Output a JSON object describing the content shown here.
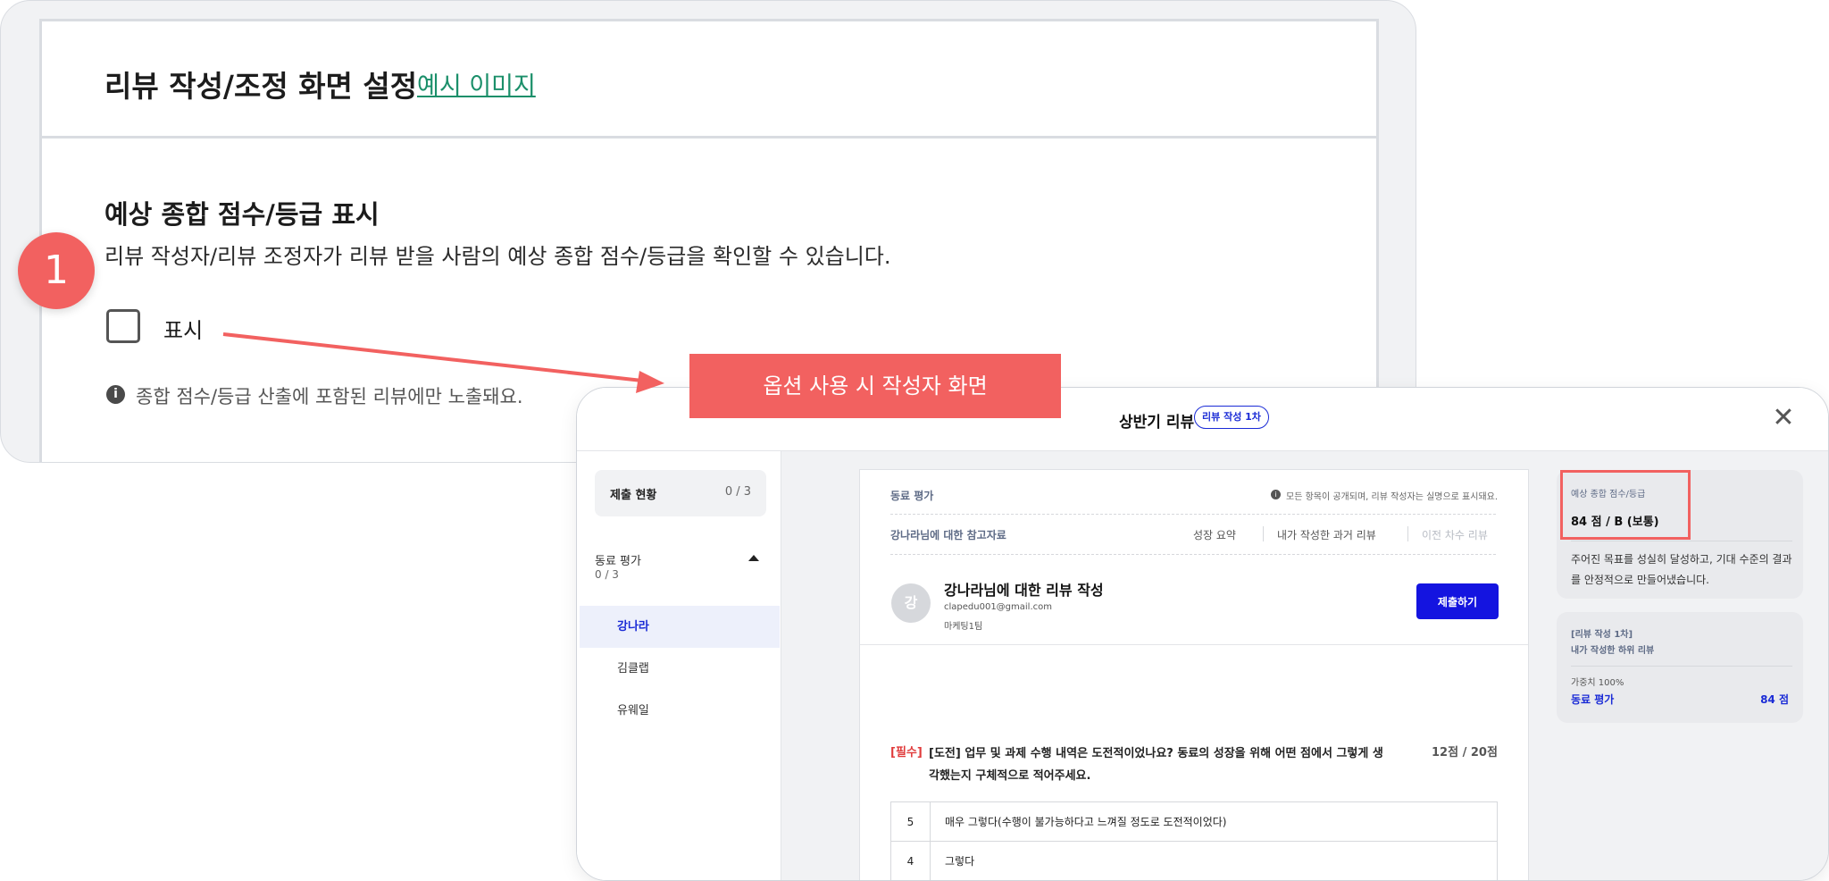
{
  "settings": {
    "title": "리뷰 작성/조정 화면 설정",
    "example_link": "예시 이미지",
    "section_title": "예상 종합 점수/등급 표시",
    "section_desc": "리뷰 작성자/리뷰 조정자가 리뷰 받을 사람의 예상 종합 점수/등급을 확인할 수 있습니다.",
    "checkbox_label": "표시",
    "checkbox_checked": false,
    "notice_icon": "info-icon",
    "notice_icon_glyph": "i",
    "notice": "종합 점수/등급 산출에 포함된 리뷰에만 노출돼요."
  },
  "annotation": {
    "step": "1",
    "callout": "옵션 사용 시 작성자 화면",
    "accent_color": "#f26160"
  },
  "modal": {
    "title": "상반기 리뷰",
    "badge": "리뷰 작성 1차",
    "close_glyph": "✕",
    "sidebar": {
      "progress_label": "제출 현황",
      "progress_value": "0 / 3",
      "group_title": "동료 평가",
      "group_count": "0 / 3",
      "items": [
        {
          "label": "강나라",
          "active": true
        },
        {
          "label": "김클랩",
          "active": false
        },
        {
          "label": "유웨일",
          "active": false
        }
      ]
    },
    "panel": {
      "label": "동료 평가",
      "info_note": "모든 항목이 공개되며, 리뷰 작성자는 실명으로 표시돼요.",
      "ref_label": "강나라님에 대한 참고자료",
      "ref_tabs": [
        {
          "label": "성장 요약",
          "enabled": true
        },
        {
          "label": "내가 작성한 과거 리뷰",
          "enabled": true
        },
        {
          "label": "이전 차수 리뷰",
          "enabled": false
        }
      ],
      "avatar_initial": "강",
      "reviewee_title": "강나라님에 대한 리뷰 작성",
      "reviewee_email": "clapedu001@gmail.com",
      "reviewee_team": "마케팅1팀",
      "submit_label": "제출하기",
      "brand_color": "#1414e0",
      "question": {
        "required": "[필수]",
        "text": "[도전] 업무 및 과제 수행 내역은 도전적이었나요? 동료의 성장을 위해 어떤 점에서 그렇게 생각했는지 구체적으로 적어주세요.",
        "score": "12점 / 20점",
        "options": [
          {
            "num": "5",
            "text": "매우 그렇다(수행이 불가능하다고 느껴질 정도로 도전적이었다)"
          },
          {
            "num": "4",
            "text": "그렇다"
          }
        ]
      }
    },
    "score_card": {
      "label": "예상 종합 점수/등급",
      "value": "84 점 / B (보통)",
      "desc": "주어진 목표를 성실히 달성하고, 기대 수준의 결과를 안정적으로 만들어냈습니다."
    },
    "weight_card": {
      "line1": "[리뷰 작성 1차]",
      "line2": "내가 작성한 하위 리뷰",
      "weight_label": "가중치 100%",
      "name": "동료 평가",
      "score": "84 점"
    }
  }
}
